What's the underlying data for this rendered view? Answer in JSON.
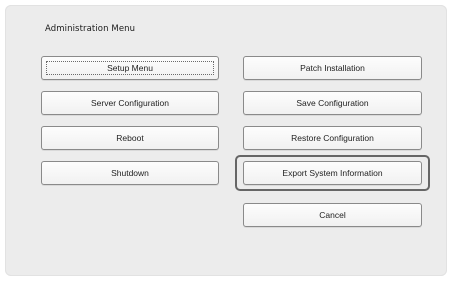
{
  "menu": {
    "title": "Administration Menu"
  },
  "buttons": {
    "setup_menu": "Setup Menu",
    "server_configuration": "Server Configuration",
    "reboot": "Reboot",
    "shutdown": "Shutdown",
    "patch_installation": "Patch Installation",
    "save_configuration": "Save Configuration",
    "restore_configuration": "Restore Configuration",
    "export_system_information": "Export System Information",
    "cancel": "Cancel"
  },
  "state": {
    "focused_button": "Setup Menu",
    "selected_button": "Export System Information"
  }
}
